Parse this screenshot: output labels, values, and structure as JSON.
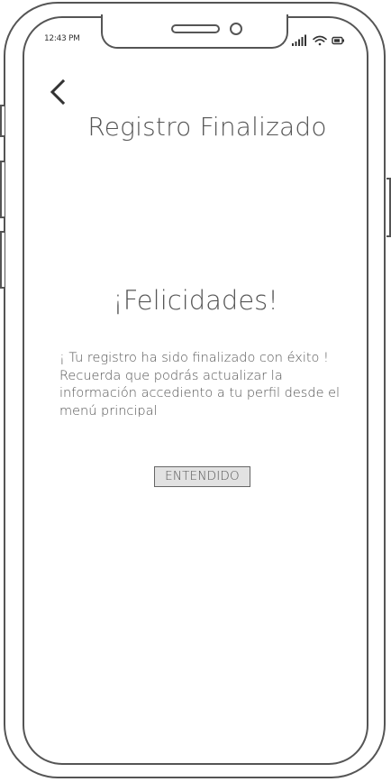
{
  "status_bar": {
    "time": "12:43 PM",
    "icons": [
      "signal-icon",
      "wifi-icon",
      "battery-icon"
    ]
  },
  "header": {
    "back_icon": "chevron-left-icon",
    "title": "Registro Finalizado"
  },
  "main": {
    "congrats": "¡Felicidades!",
    "message_lines": [
      "¡ Tu registro ha sido finalizado con éxito !",
      "Recuerda que podrás actualizar la",
      "información accediento a tu perfil desde el",
      "menú principal"
    ],
    "ok_button_label": "ENTENDIDO"
  },
  "colors": {
    "frame": "#555555",
    "button_bg": "#e2e2e2",
    "text": "#555555"
  }
}
